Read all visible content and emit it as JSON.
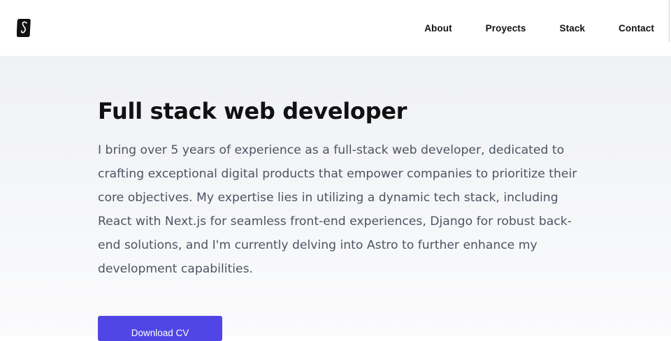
{
  "header": {
    "logo_icon": "brand-logo-icon",
    "nav": [
      {
        "label": "About"
      },
      {
        "label": "Proyects"
      },
      {
        "label": "Stack"
      },
      {
        "label": "Contact"
      }
    ]
  },
  "hero": {
    "title": "Full stack web developer",
    "description": "I bring over 5 years of experience as a full-stack web developer, dedicated to crafting exceptional digital products that empower companies to prioritize their core objectives. My expertise lies in utilizing a dynamic tech stack, including React with Next.js for seamless front-end experiences, Django for robust back-end solutions, and I'm currently delving into Astro to further enhance my development capabilities.",
    "cta_label": "Download CV"
  },
  "colors": {
    "accent": "#4f46e5",
    "text": "#111111",
    "muted": "#4b5563",
    "hero_bg": "#f0f1f5"
  }
}
